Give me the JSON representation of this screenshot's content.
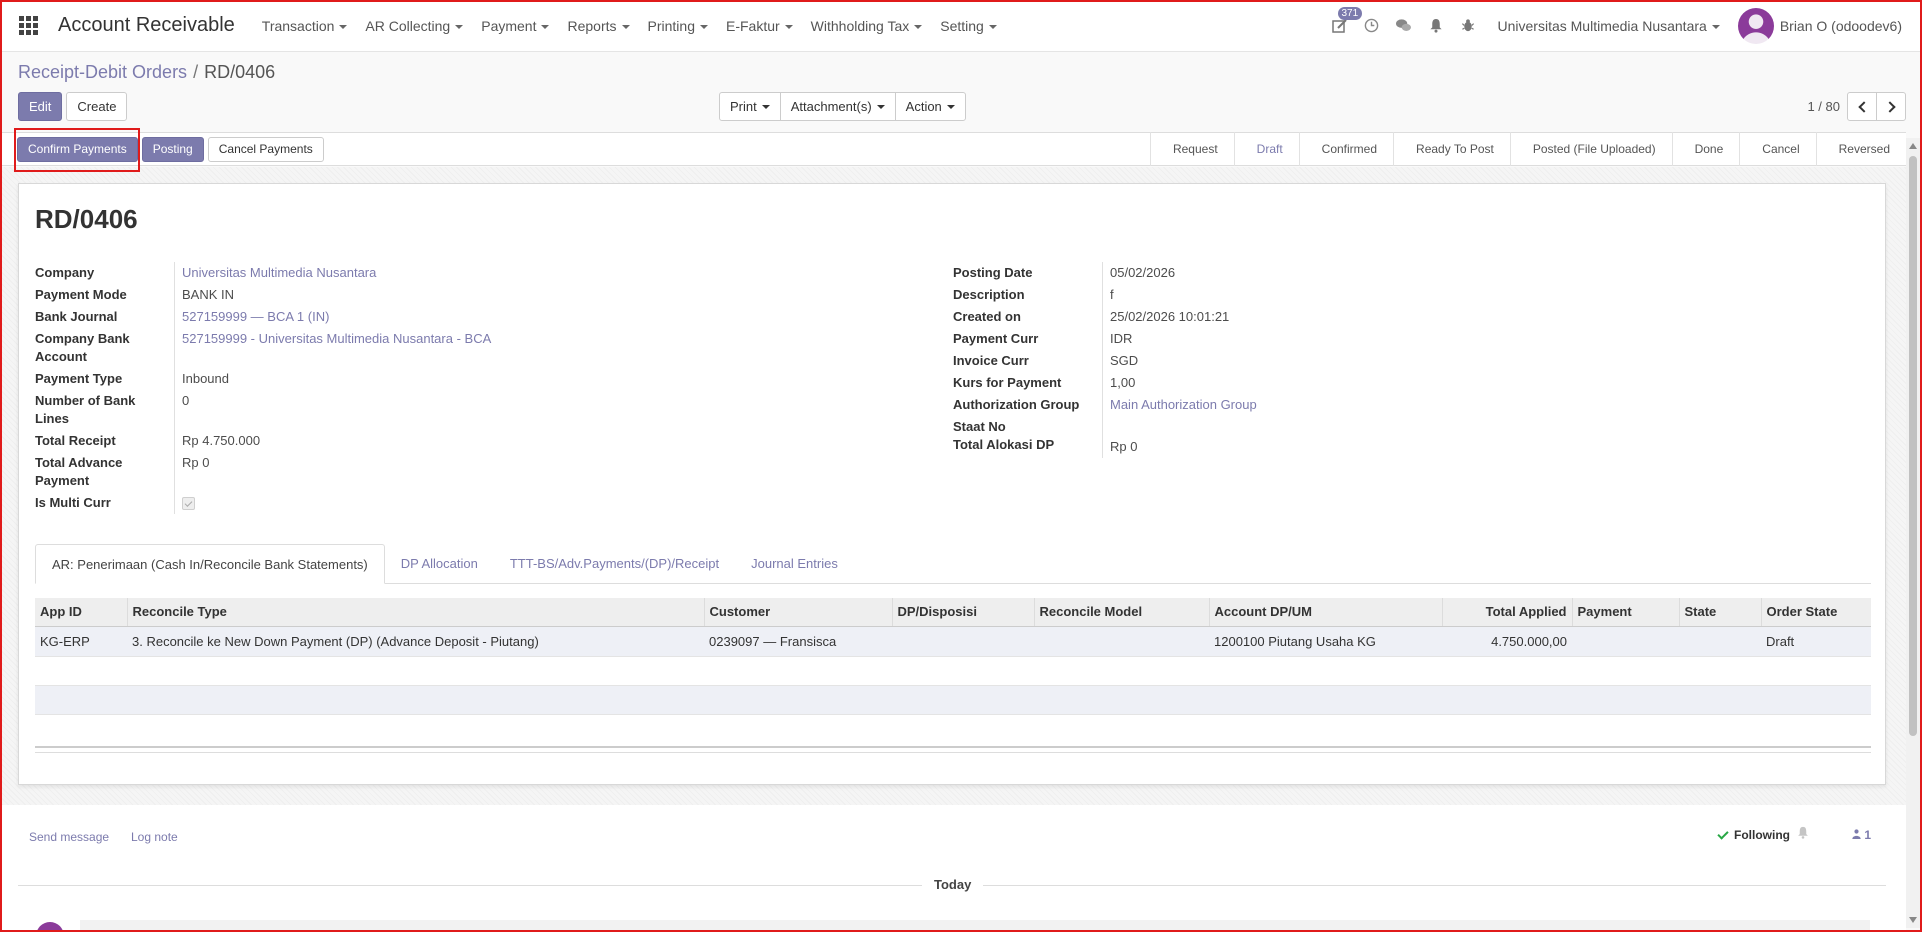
{
  "navbar": {
    "app_title": "Account Receivable",
    "menus": [
      "Transaction",
      "AR Collecting",
      "Payment",
      "Reports",
      "Printing",
      "E-Faktur",
      "Withholding Tax",
      "Setting"
    ],
    "activity_badge": "371",
    "company": "Universitas Multimedia Nusantara",
    "user": "Brian O (odoodev6)"
  },
  "breadcrumb": {
    "parent": "Receipt-Debit Orders",
    "separator": "/",
    "current": "RD/0406"
  },
  "control": {
    "edit": "Edit",
    "create": "Create",
    "print": "Print",
    "attachments": "Attachment(s)",
    "action": "Action",
    "pager": "1 / 80"
  },
  "statusbar": {
    "buttons": [
      "Confirm Payments",
      "Posting",
      "Cancel Payments"
    ],
    "stages": [
      "Request",
      "Draft",
      "Confirmed",
      "Ready To Post",
      "Posted (File Uploaded)",
      "Done",
      "Cancel",
      "Reversed"
    ],
    "current_stage": "Draft"
  },
  "record": {
    "title": "RD/0406",
    "left_fields": [
      {
        "label": "Company",
        "value": "Universitas Multimedia Nusantara",
        "link": true
      },
      {
        "label": "Payment Mode",
        "value": "BANK IN",
        "link": false
      },
      {
        "label": "Bank Journal",
        "value": "527159999 — BCA 1 (IN)",
        "link": true
      },
      {
        "label": "Company Bank Account",
        "value": "527159999 - Universitas Multimedia Nusantara - BCA",
        "link": true
      },
      {
        "label": "Payment Type",
        "value": "Inbound",
        "link": false
      },
      {
        "label": "Number of Bank Lines",
        "value": "0",
        "link": false
      },
      {
        "label": "Total Receipt",
        "value": "Rp 4.750.000",
        "link": false
      },
      {
        "label": "Total Advance Payment",
        "value": "Rp 0",
        "link": false
      },
      {
        "label": "Is Multi Curr",
        "value": "",
        "link": false
      }
    ],
    "right_fields": [
      {
        "label": "Posting Date",
        "value": "05/02/2026",
        "link": false
      },
      {
        "label": "Description",
        "value": "f",
        "link": false
      },
      {
        "label": "Created on",
        "value": "25/02/2026 10:01:21",
        "link": false
      },
      {
        "label": "Payment Curr",
        "value": "IDR",
        "link": false
      },
      {
        "label": "Invoice Curr",
        "value": "SGD",
        "link": false
      },
      {
        "label": "Kurs for Payment",
        "value": "1,00",
        "link": false
      },
      {
        "label": "Authorization Group",
        "value": "Main Authorization Group",
        "link": true
      },
      {
        "label": "Staat No",
        "value": "",
        "link": false
      },
      {
        "label": "Total Alokasi DP",
        "value": "Rp 0",
        "link": false
      }
    ]
  },
  "tabs": [
    "AR: Penerimaan (Cash In/Reconcile Bank Statements)",
    "DP Allocation",
    "TTT-BS/Adv.Payments/(DP)/Receipt",
    "Journal Entries"
  ],
  "table": {
    "columns": [
      "App ID",
      "Reconcile Type",
      "Customer",
      "DP/Disposisi",
      "Reconcile Model",
      "Account DP/UM",
      "Total Applied",
      "Payment",
      "State",
      "Order State"
    ],
    "rows": [
      [
        "KG-ERP",
        "3. Reconcile ke New Down Payment (DP) (Advance Deposit - Piutang)",
        "0239097 — Fransisca",
        "",
        "",
        "1200100 Piutang Usaha KG",
        "4.750.000,00",
        "",
        "",
        "Draft"
      ]
    ]
  },
  "chatter": {
    "send_message": "Send message",
    "log_note": "Log note",
    "following": "Following",
    "followers": "1",
    "today": "Today"
  }
}
